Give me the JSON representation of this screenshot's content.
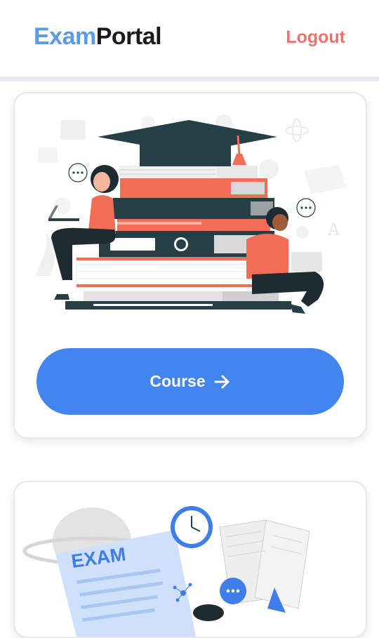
{
  "header": {
    "brand_part1": "Exam",
    "brand_part2": "Portal",
    "logout_label": "Logout"
  },
  "cards": [
    {
      "illustration": "students-with-books-and-graduation-cap",
      "button_label": "Course",
      "button_icon": "arrow-right-icon"
    },
    {
      "illustration": "exam-paper-clock-open-book",
      "exam_label": "EXAM"
    }
  ],
  "colors": {
    "brand_blue": "#5b9be6",
    "brand_dark": "#1b1b1b",
    "logout": "#e8746f",
    "button": "#4285ee",
    "coral": "#f26d55",
    "dark_slate": "#263f47"
  }
}
